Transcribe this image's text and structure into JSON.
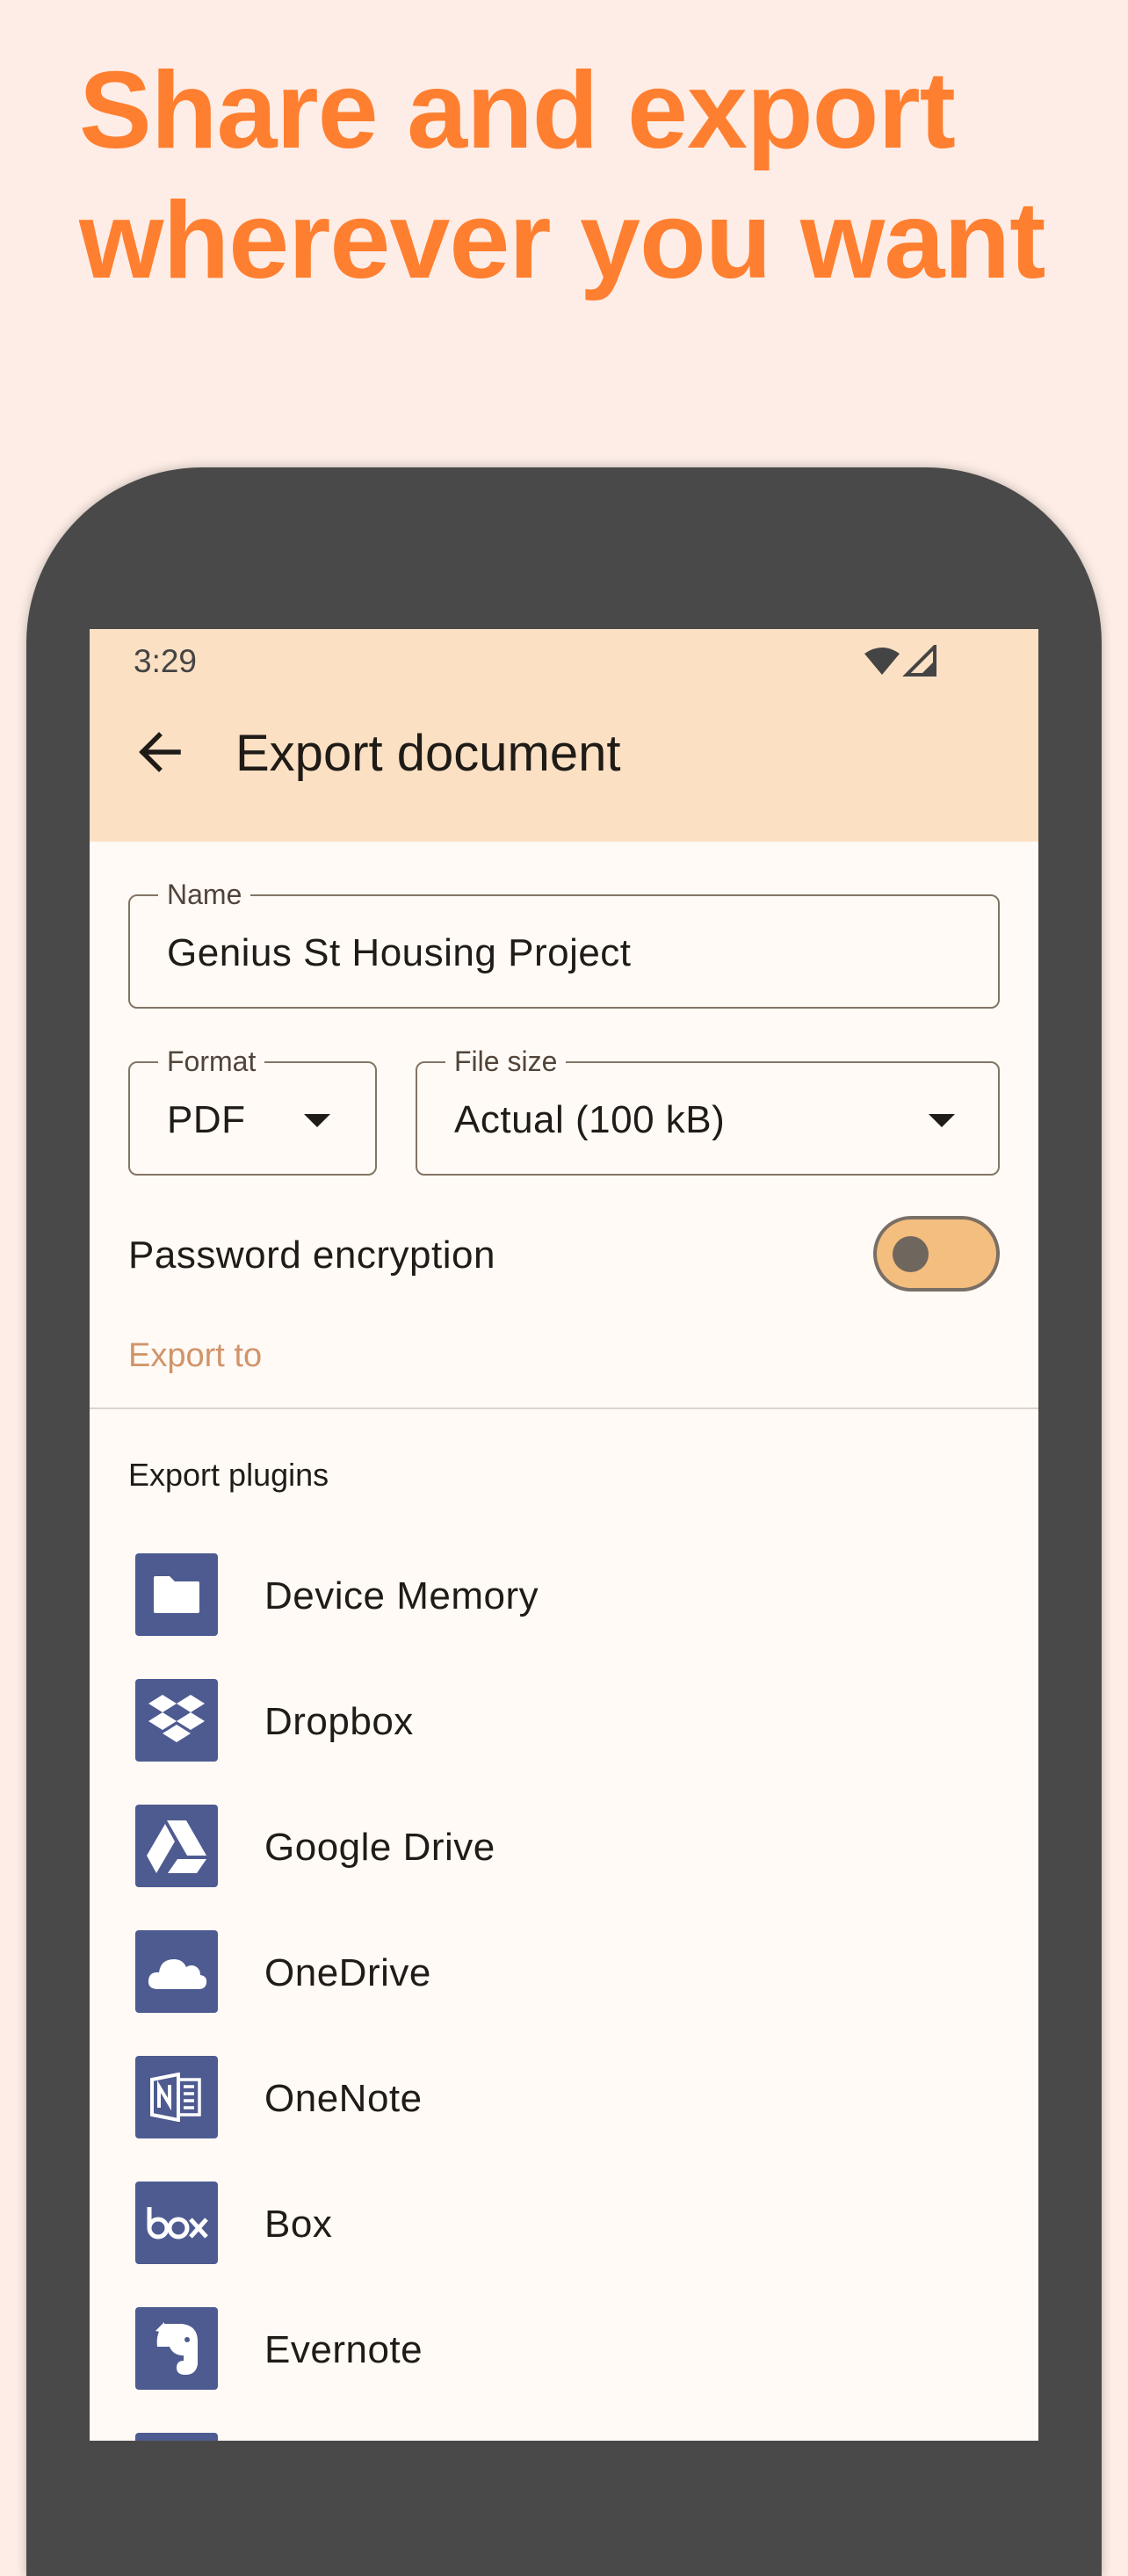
{
  "promo": {
    "headline": "Share and export wherever you want"
  },
  "status_bar": {
    "time": "3:29",
    "icons": [
      "wifi-icon",
      "signal-icon"
    ]
  },
  "app_bar": {
    "back_icon": "arrow-back-icon",
    "title": "Export document"
  },
  "form": {
    "name": {
      "label": "Name",
      "value": "Genius St Housing Project"
    },
    "format": {
      "label": "Format",
      "value": "PDF"
    },
    "file_size": {
      "label": "File size",
      "value": "Actual (100 kB)"
    },
    "password_encryption": {
      "label": "Password encryption",
      "enabled": false
    },
    "export_to_label": "Export to"
  },
  "plugins": {
    "header": "Export plugins",
    "items": [
      {
        "label": "Device Memory",
        "icon": "folder-icon"
      },
      {
        "label": "Dropbox",
        "icon": "dropbox-icon"
      },
      {
        "label": "Google Drive",
        "icon": "google-drive-icon"
      },
      {
        "label": "OneDrive",
        "icon": "onedrive-icon"
      },
      {
        "label": "OneNote",
        "icon": "onenote-icon"
      },
      {
        "label": "Box",
        "icon": "box-icon"
      },
      {
        "label": "Evernote",
        "icon": "evernote-icon"
      }
    ]
  },
  "colors": {
    "background": "#FDEDE6",
    "headline": "#FF7F30",
    "app_bar": "#FBE0C4",
    "screen": "#FFFAF5",
    "accent_text": "#D1946A",
    "plugin_icon_bg": "#4E5B91",
    "toggle_track": "#F4BE7E"
  }
}
